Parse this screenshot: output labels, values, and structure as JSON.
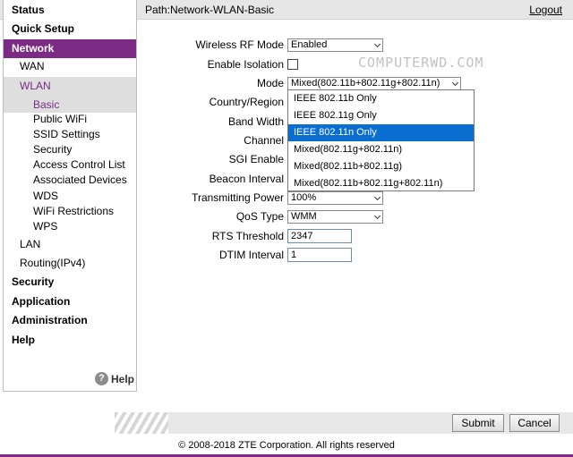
{
  "header": {
    "path": "Path:Network-WLAN-Basic",
    "logout": "Logout"
  },
  "sidebar": {
    "status": "Status",
    "quick_setup": "Quick Setup",
    "network": "Network",
    "wan": "WAN",
    "wlan": "WLAN",
    "basic": "Basic",
    "public_wifi": "Public WiFi",
    "ssid_settings": "SSID Settings",
    "security_sub": "Security",
    "access_control": "Access Control List",
    "associated_devices": "Associated Devices",
    "wds": "WDS",
    "wifi_restrictions": "WiFi Restrictions",
    "wps": "WPS",
    "lan": "LAN",
    "routing": "Routing(IPv4)",
    "security": "Security",
    "application": "Application",
    "administration": "Administration",
    "help": "Help",
    "help_footer": "Help",
    "help_glyph": "?"
  },
  "watermark": "COMPUTERWD.COM",
  "form": {
    "wireless_rf_mode": {
      "label": "Wireless RF Mode",
      "value": "Enabled"
    },
    "enable_isolation": {
      "label": "Enable Isolation",
      "checked": false
    },
    "mode": {
      "label": "Mode",
      "value": "Mixed(802.11b+802.11g+802.11n)"
    },
    "country_region": {
      "label": "Country/Region"
    },
    "band_width": {
      "label": "Band Width"
    },
    "channel": {
      "label": "Channel"
    },
    "sgi_enable": {
      "label": "SGI Enable"
    },
    "beacon_interval": {
      "label": "Beacon Interval"
    },
    "transmitting_power": {
      "label": "Transmitting Power",
      "value": "100%"
    },
    "qos_type": {
      "label": "QoS Type",
      "value": "WMM"
    },
    "rts_threshold": {
      "label": "RTS Threshold",
      "value": "2347"
    },
    "dtim_interval": {
      "label": "DTIM Interval",
      "value": "1"
    }
  },
  "mode_dropdown": {
    "options": [
      "IEEE 802.11b Only",
      "IEEE 802.11g Only",
      "IEEE 802.11n Only",
      "Mixed(802.11g+802.11n)",
      "Mixed(802.11b+802.11g)",
      "Mixed(802.11b+802.11g+802.11n)"
    ],
    "highlighted": "IEEE 802.11n Only"
  },
  "buttons": {
    "submit": "Submit",
    "cancel": "Cancel"
  },
  "footer": "© 2008-2018 ZTE Corporation. All rights reserved",
  "colors": {
    "accent": "#7b2b84",
    "highlight": "#0a6ed1"
  }
}
